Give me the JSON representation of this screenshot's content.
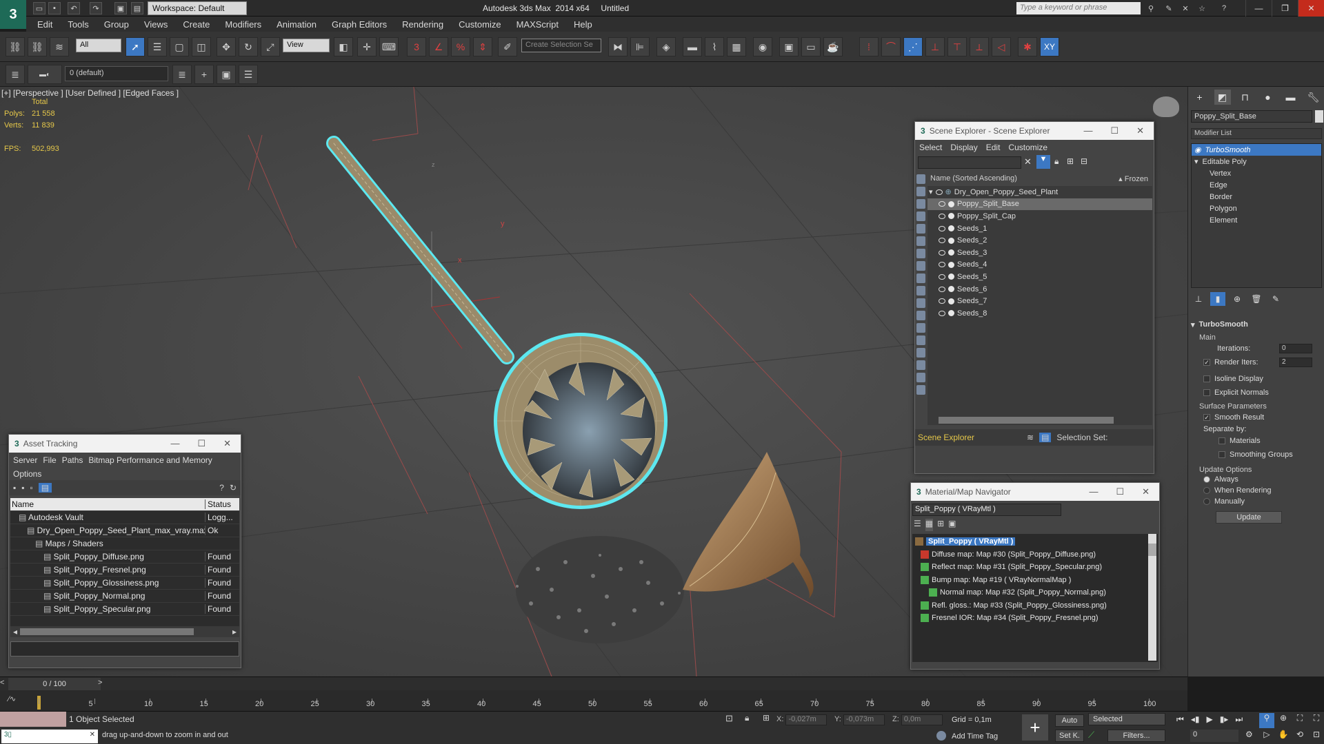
{
  "window": {
    "workspace": "Workspace: Default",
    "title": "Autodesk 3ds Max  2014 x64     Untitled",
    "search_placeholder": "Type a keyword or phrase"
  },
  "menu": [
    "Edit",
    "Tools",
    "Group",
    "Views",
    "Create",
    "Modifiers",
    "Animation",
    "Graph Editors",
    "Rendering",
    "Customize",
    "MAXScript",
    "Help"
  ],
  "toolbar": {
    "selection_filter": "All",
    "ref_coord": "View",
    "selection_set": "Create Selection Se",
    "axis_label": "XY"
  },
  "layer": {
    "name": "0 (default)"
  },
  "viewport": {
    "label": "[+] [Perspective ] [User Defined ] [Edged Faces ]",
    "stats_total": "Total",
    "polys_label": "Polys:",
    "polys": "21 558",
    "verts_label": "Verts:",
    "verts": "11 839",
    "fps_label": "FPS:",
    "fps": "502,993",
    "gizmo_y": "y",
    "gizmo_x": "x",
    "gizmo_z": "z"
  },
  "command_panel": {
    "object_name": "Poppy_Split_Base",
    "modifier_list": "Modifier List",
    "stack": [
      {
        "label": "TurboSmooth",
        "level": 0,
        "selected": true
      },
      {
        "label": "Editable Poly",
        "level": 0,
        "selected": false
      },
      {
        "label": "Vertex",
        "level": 1,
        "selected": false
      },
      {
        "label": "Edge",
        "level": 1,
        "selected": false
      },
      {
        "label": "Border",
        "level": 1,
        "selected": false
      },
      {
        "label": "Polygon",
        "level": 1,
        "selected": false
      },
      {
        "label": "Element",
        "level": 1,
        "selected": false
      }
    ],
    "rollout_title": "TurboSmooth",
    "main": "Main",
    "iterations_label": "Iterations:",
    "iterations": "0",
    "render_iters_label": "Render Iters:",
    "render_iters": "2",
    "isoline": "Isoline Display",
    "explicit_normals": "Explicit Normals",
    "surface_params": "Surface Parameters",
    "smooth_result": "Smooth Result",
    "separate_by": "Separate by:",
    "materials": "Materials",
    "smoothing_groups": "Smoothing Groups",
    "update_options": "Update Options",
    "always": "Always",
    "when_rendering": "When Rendering",
    "manually": "Manually",
    "update": "Update"
  },
  "scene_explorer": {
    "title": "Scene Explorer - Scene Explorer",
    "menu": [
      "Select",
      "Display",
      "Edit",
      "Customize"
    ],
    "column": "Name (Sorted Ascending)",
    "frozen": "▴ Frozen",
    "root": "Dry_Open_Poppy_Seed_Plant",
    "items": [
      "Poppy_Split_Base",
      "Poppy_Split_Cap",
      "Seeds_1",
      "Seeds_2",
      "Seeds_3",
      "Seeds_4",
      "Seeds_5",
      "Seeds_6",
      "Seeds_7",
      "Seeds_8"
    ],
    "selected_item": "Poppy_Split_Base",
    "footer_name": "Scene Explorer",
    "selection_set": "Selection Set:"
  },
  "asset_tracking": {
    "title": "Asset Tracking",
    "menu": [
      "Server",
      "File",
      "Paths",
      "Bitmap Performance and Memory"
    ],
    "menu2": "Options",
    "col_name": "Name",
    "col_status": "Status",
    "rows": [
      {
        "name": "Autodesk Vault",
        "status": "Logg...",
        "indent": 1
      },
      {
        "name": "Dry_Open_Poppy_Seed_Plant_max_vray.max",
        "status": "Ok",
        "indent": 2
      },
      {
        "name": "Maps / Shaders",
        "status": "",
        "indent": 3
      },
      {
        "name": "Split_Poppy_Diffuse.png",
        "status": "Found",
        "indent": 4
      },
      {
        "name": "Split_Poppy_Fresnel.png",
        "status": "Found",
        "indent": 4
      },
      {
        "name": "Split_Poppy_Glossiness.png",
        "status": "Found",
        "indent": 4
      },
      {
        "name": "Split_Poppy_Normal.png",
        "status": "Found",
        "indent": 4
      },
      {
        "name": "Split_Poppy_Specular.png",
        "status": "Found",
        "indent": 4
      }
    ]
  },
  "material_navigator": {
    "title": "Material/Map Navigator",
    "current": "Split_Poppy  ( VRayMtl )",
    "root": "Split_Poppy  ( VRayMtl )",
    "maps": [
      {
        "label": "Diffuse map: Map #30 (Split_Poppy_Diffuse.png)",
        "color": "#c8382c",
        "indent": 0
      },
      {
        "label": "Reflect map: Map #31 (Split_Poppy_Specular.png)",
        "color": "#4caf50",
        "indent": 0
      },
      {
        "label": "Bump map: Map #19  ( VRayNormalMap )",
        "color": "#4caf50",
        "indent": 0
      },
      {
        "label": "Normal map: Map #32 (Split_Poppy_Normal.png)",
        "color": "#4caf50",
        "indent": 1
      },
      {
        "label": "Refl. gloss.: Map #33 (Split_Poppy_Glossiness.png)",
        "color": "#4caf50",
        "indent": 0
      },
      {
        "label": "Fresnel IOR: Map #34 (Split_Poppy_Fresnel.png)",
        "color": "#4caf50",
        "indent": 0
      }
    ]
  },
  "timeline": {
    "frame": "0 / 100",
    "ticks": [
      "0",
      "5",
      "10",
      "15",
      "20",
      "25",
      "30",
      "35",
      "40",
      "45",
      "50",
      "55",
      "60",
      "65",
      "70",
      "75",
      "80",
      "85",
      "90",
      "95",
      "100"
    ]
  },
  "status": {
    "selection": "1 Object Selected",
    "prompt": "drag up-and-down to zoom in and out",
    "x_label": "X:",
    "x": "-0,027m",
    "y_label": "Y:",
    "y": "-0,073m",
    "z_label": "Z:",
    "z": "0,0m",
    "grid": "Grid = 0,1m",
    "auto": "Auto",
    "selected": "Selected",
    "set_key": "Set K.",
    "filters": "Filters...",
    "add_time_tag": "Add Time Tag",
    "frame": "0"
  },
  "colors": {
    "accent": "#3c78c3",
    "selection_highlight": "#5de8f0",
    "stats": "#e6c84a"
  }
}
